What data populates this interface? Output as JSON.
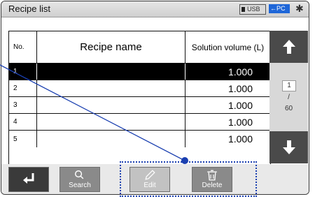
{
  "title": "Recipe list",
  "status": {
    "usb": "USB",
    "pc": "PC",
    "pc_arrow": "←",
    "bluetooth": "✱"
  },
  "table": {
    "headers": {
      "no": "No.",
      "name": "Recipe name",
      "volume": "Solution volume (L)"
    },
    "rows": [
      {
        "no": "1",
        "name": "",
        "volume": "1.000"
      },
      {
        "no": "2",
        "name": "",
        "volume": "1.000"
      },
      {
        "no": "3",
        "name": "",
        "volume": "1.000"
      },
      {
        "no": "4",
        "name": "",
        "volume": "1.000"
      },
      {
        "no": "5",
        "name": "",
        "volume": "1.000"
      }
    ]
  },
  "pager": {
    "current": "1",
    "separator": "/",
    "total": "60"
  },
  "buttons": {
    "search": "Search",
    "edit": "Edit",
    "delete": "Delete"
  },
  "icons": {
    "up": "arrow-up-icon",
    "down": "arrow-down-icon",
    "back": "return-icon",
    "search": "magnifier-icon",
    "edit": "pencil-icon",
    "delete": "trash-icon"
  }
}
